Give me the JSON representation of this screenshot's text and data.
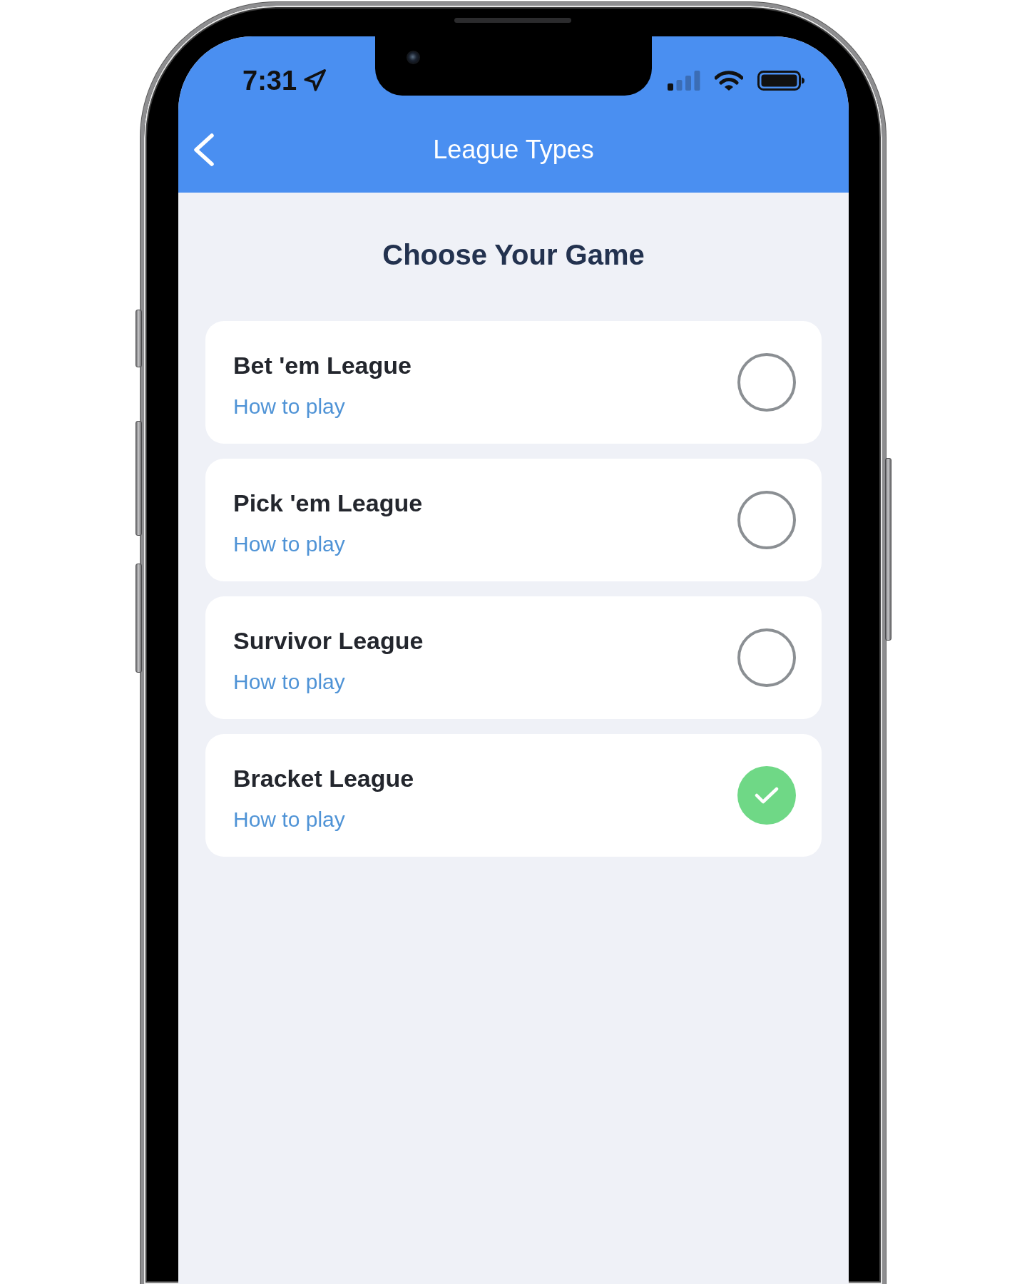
{
  "status_bar": {
    "time": "7:31"
  },
  "header": {
    "title": "League Types"
  },
  "heading": "Choose Your Game",
  "leagues": [
    {
      "name": "Bet 'em League",
      "link": "How to play",
      "selected": false
    },
    {
      "name": "Pick 'em League",
      "link": "How to play",
      "selected": false
    },
    {
      "name": "Survivor League",
      "link": "How to play",
      "selected": false
    },
    {
      "name": "Bracket League",
      "link": "How to play",
      "selected": true
    }
  ]
}
